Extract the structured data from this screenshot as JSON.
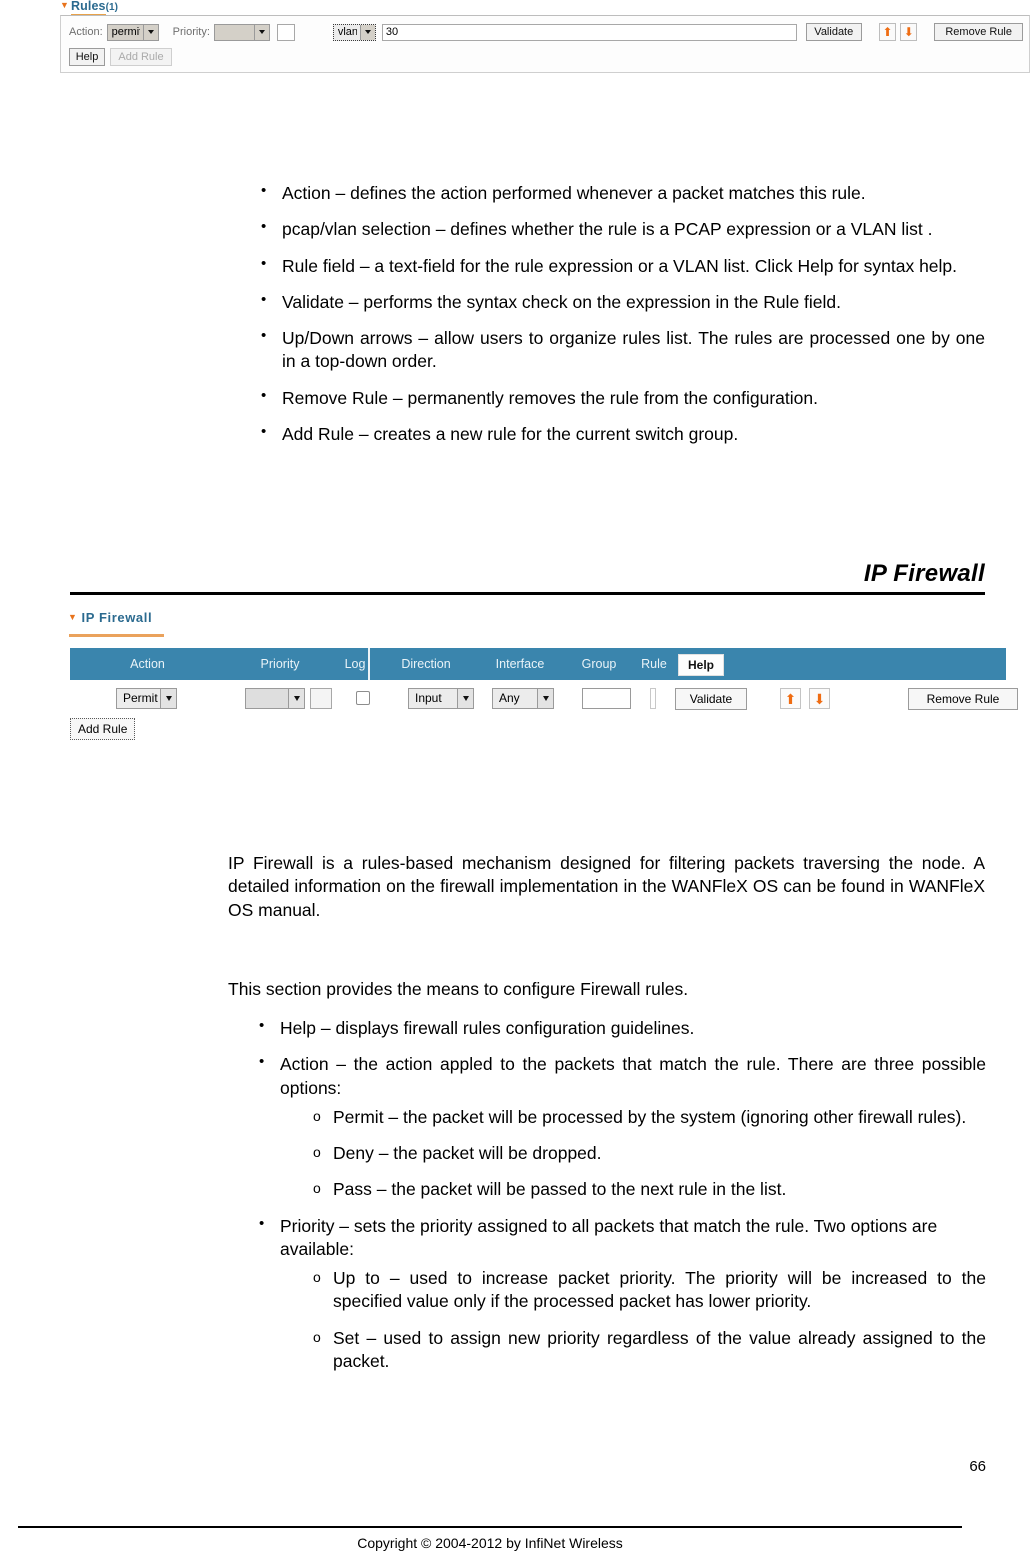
{
  "rules_panel": {
    "title": "Rules",
    "count": "(1)",
    "collapse_icon": "triangle-down-icon",
    "action_label": "Action:",
    "action_value": "permit",
    "priority_label": "Priority:",
    "priority_value": "",
    "priority_extra_value": "",
    "mode_value": "vlan",
    "rule_value": "30",
    "validate_label": "Validate",
    "up_icon": "arrow-up-icon",
    "down_icon": "arrow-down-icon",
    "remove_label": "Remove Rule",
    "help_label": "Help",
    "add_rule_label": "Add Rule"
  },
  "switch_group_bullets": [
    "Action – defines the action performed whenever a packet matches this rule.",
    "pcap/vlan selection – defines whether the rule is a PCAP expression or a VLAN list .",
    "Rule field – a text-field for the rule expression or a VLAN list. Click Help for syntax help.",
    "Validate – performs the syntax check on the expression in the Rule field.",
    "Up/Down arrows – allow users to organize rules list. The rules are processed one by one in a top-down order.",
    "Remove Rule – permanently removes the rule from the configuration.",
    "Add Rule – creates a new rule for the current switch group."
  ],
  "section": {
    "heading": "IP Firewall"
  },
  "firewall_panel": {
    "title": "IP Firewall",
    "collapse_icon": "triangle-down-icon",
    "columns": [
      "Action",
      "Priority",
      "Log",
      "Direction",
      "Interface",
      "Group",
      "Rule"
    ],
    "help_label": "Help",
    "action_value": "Permit",
    "priority_value": "",
    "priority_extra_value": "",
    "log_checked": false,
    "direction_value": "Input",
    "interface_value": "Any",
    "group_value": "",
    "rule_value": "",
    "validate_label": "Validate",
    "up_icon": "arrow-up-icon",
    "down_icon": "arrow-down-icon",
    "remove_label": "Remove Rule",
    "add_rule_label": "Add Rule",
    "header_color": "#3a85ad",
    "accent_color": "#eaa25c",
    "arrow_color": "#ef6c12"
  },
  "intro_paragraph": "IP Firewall is a rules-based mechanism designed for filtering packets traversing the node. A detailed information on the firewall implementation in the WANFleX OS can be found in WANFleX OS manual.",
  "section_lead": "This section provides the means to configure Firewall rules.",
  "firewall_bullets": [
    {
      "text": "Help – displays firewall rules configuration guidelines.",
      "sub": []
    },
    {
      "text": "Action – the action appled to the packets that match the rule. There are three possible options:",
      "sub": [
        "Permit – the packet will be processed by the system (ignoring other firewall rules).",
        "Deny – the packet will be dropped.",
        "Pass – the packet will be passed to the next rule in the list."
      ]
    },
    {
      "text": "Priority – sets the priority assigned to all packets that match the rule. Two options are available:",
      "sub": [
        "Up to – used to increase packet priority. The priority will be increased to the specified value only if the processed packet has lower priority.",
        "Set – used to assign new priority regardless of the value already assigned to the packet."
      ]
    }
  ],
  "page_number": "66",
  "footer": "Copyright © 2004-2012 by InfiNet Wireless"
}
